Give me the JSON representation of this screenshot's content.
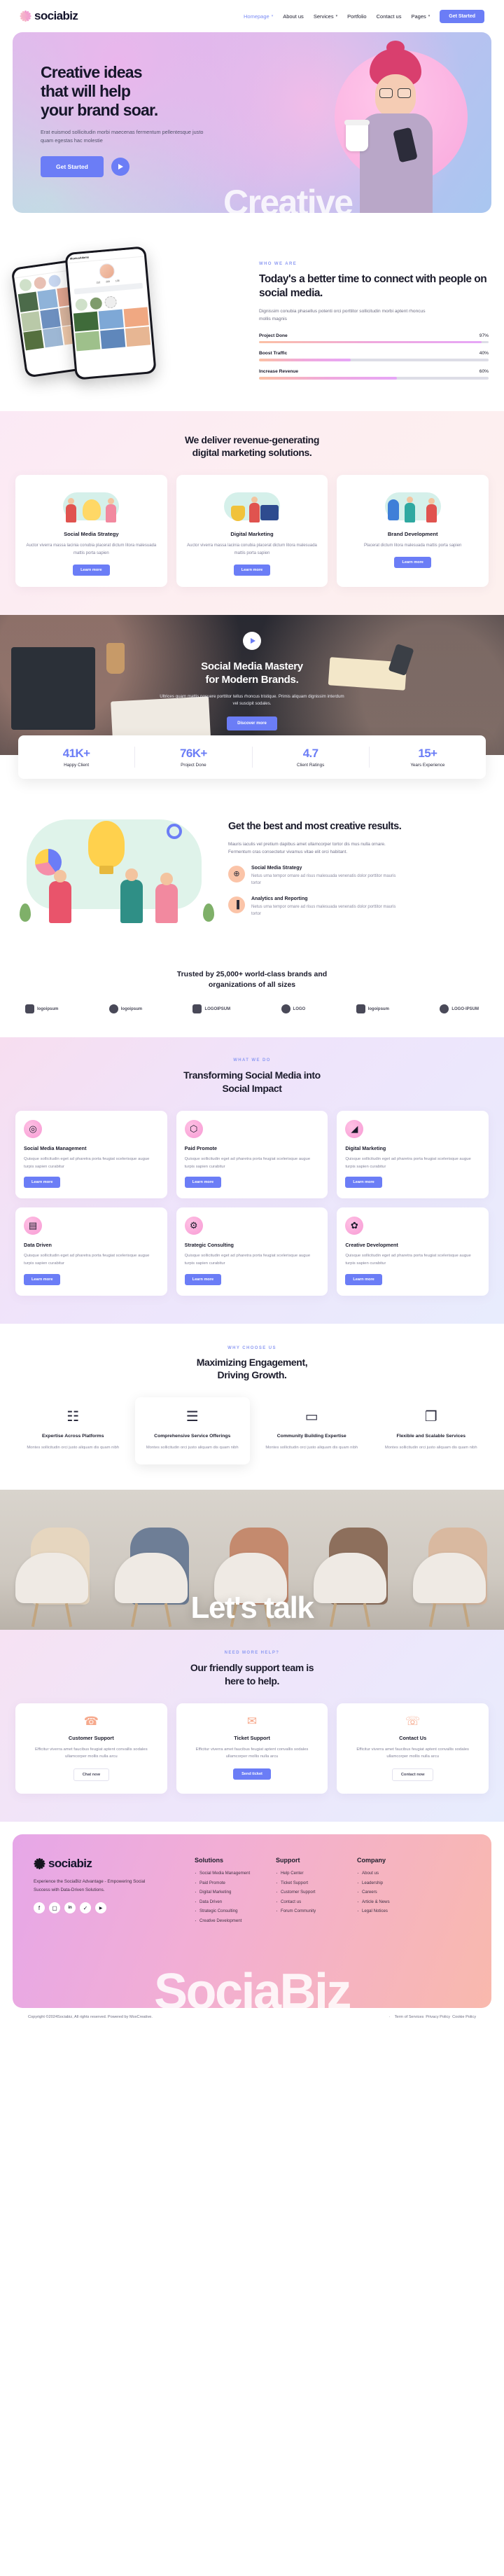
{
  "nav": {
    "brand": "sociabiz",
    "items": [
      {
        "label": "Homepage",
        "caret": true,
        "active": true
      },
      {
        "label": "About us",
        "caret": false,
        "active": false
      },
      {
        "label": "Services",
        "caret": true,
        "active": false
      },
      {
        "label": "Portfolio",
        "caret": false,
        "active": false
      },
      {
        "label": "Contact us",
        "caret": false,
        "active": false
      },
      {
        "label": "Pages",
        "caret": true,
        "active": false
      }
    ],
    "cta": "Get Started"
  },
  "hero": {
    "title_line1": "Creative ideas",
    "title_line2": "that will help",
    "title_line3": "your brand soar.",
    "paragraph": "Erat euismod sollicitudin morbi maecenas fermentum pellentesque justo quam egestas hac molestie",
    "cta": "Get Started",
    "watermark": "Creative"
  },
  "about": {
    "eyebrow": "WHO WE ARE",
    "title": "Today's a better time to connect with people on social media.",
    "paragraph": "Dignissim conubia phasellus potenti orci porttitor sollicitudin morbi aptent rhoncus mollis magnis",
    "bars": [
      {
        "label": "Project Done",
        "value": "97%",
        "pct": 97
      },
      {
        "label": "Boost Traffic",
        "value": "40%",
        "pct": 40
      },
      {
        "label": "Increase Revenue",
        "value": "60%",
        "pct": 60
      }
    ],
    "phone_profile": {
      "handle": "MonicaAdams",
      "name": "Monica Adams",
      "bio": "La description de mon profil",
      "posts": "152",
      "posts_label": "Post",
      "followers": "209",
      "followers_label": "Followers",
      "following": "138",
      "following_label": "Following",
      "edit": "Edit Profile",
      "story1": "Zorg",
      "story2": "Remove",
      "story3": "New"
    }
  },
  "services": {
    "title_line1": "We deliver revenue-generating",
    "title_line2": "digital marketing solutions.",
    "cards": [
      {
        "title": "Social Media Strategy",
        "text": "Auctor viverra massa lacinia conubia placerat dictum litora malesuada mattis porta sapien",
        "cta": "Learn more"
      },
      {
        "title": "Digital Marketing",
        "text": "Auctor viverra massa lacinia conubia placerat dictum litora malesuada mattis porta sapien",
        "cta": "Learn more"
      },
      {
        "title": "Brand Development",
        "text": "Placerat dictum litora malesuada mattis porta sapien",
        "cta": "Learn more"
      }
    ]
  },
  "video": {
    "title_line1": "Social Media Mastery",
    "title_line2": "for Modern Brands.",
    "paragraph": "Ultrices quam mattis posuere porttitor tellus rhoncus tristique. Primis aliquam dignissim interdum vel suscipit sodales.",
    "cta": "Discover more"
  },
  "stats": [
    {
      "num": "41K+",
      "label": "Happy Client"
    },
    {
      "num": "76K+",
      "label": "Project Done"
    },
    {
      "num": "4.7",
      "label": "Client Ratings"
    },
    {
      "num": "15+",
      "label": "Years Experience"
    }
  ],
  "features": {
    "title": "Get the best and most creative results.",
    "paragraph": "Mauris iaculis vel pretium dapibus amet ullamcorper tortor dis mus nulla ornare. Fermentum cras consectetur vivamus vitae elit orci habitant.",
    "items": [
      {
        "icon": "globe-icon",
        "glyph": "⊕",
        "title": "Social Media Strategy",
        "text": "Netus urna tempor ornare ad risus malesuada venenatis dolor porttitor mauris tortor"
      },
      {
        "icon": "bar-chart-icon",
        "glyph": "▐",
        "title": "Analytics and Reporting",
        "text": "Netus urna tempor ornare ad risus malesuada venenatis dolor porttitor mauris tortor"
      }
    ]
  },
  "trusted": {
    "title_line1": "Trusted by 25,000+ world-class brands and",
    "title_line2": "organizations of all sizes",
    "brands": [
      "logoipsum",
      "logoipsum",
      "LOGOIPSUM",
      "LOGO",
      "logoipsum",
      "LOGO·IPSUM"
    ]
  },
  "whatwedo": {
    "eyebrow": "WHAT WE DO",
    "title_line1": "Transforming Social Media into",
    "title_line2": "Social Impact",
    "cards": [
      {
        "icon": "target-icon",
        "glyph": "◎",
        "title": "Social Media Management",
        "text": "Quisque sollicitudin eget ad pharetra porta feugiat scelerisque augue turpis sapien curabitur",
        "cta": "Learn more"
      },
      {
        "icon": "layers-icon",
        "glyph": "⬡",
        "title": "Paid Promote",
        "text": "Quisque sollicitudin eget ad pharetra porta feugiat scelerisque augue turpis sapien curabitur",
        "cta": "Learn more"
      },
      {
        "icon": "megaphone-icon",
        "glyph": "◢",
        "title": "Digital Marketing",
        "text": "Quisque sollicitudin eget ad pharetra porta feugiat scelerisque augue turpis sapien curabitur",
        "cta": "Learn more"
      },
      {
        "icon": "database-icon",
        "glyph": "▤",
        "title": "Data Driven",
        "text": "Quisque sollicitudin eget ad pharetra porta feugiat scelerisque augue turpis sapien curabitur",
        "cta": "Learn more"
      },
      {
        "icon": "strategy-icon",
        "glyph": "⚙",
        "title": "Strategic Consulting",
        "text": "Quisque sollicitudin eget ad pharetra porta feugiat scelerisque augue turpis sapien curabitur",
        "cta": "Learn more"
      },
      {
        "icon": "palette-icon",
        "glyph": "✿",
        "title": "Creative Development",
        "text": "Quisque sollicitudin eget ad pharetra porta feugiat scelerisque augue turpis sapien curabitur",
        "cta": "Learn more"
      }
    ]
  },
  "maximizing": {
    "eyebrow": "WHY CHOOSE US",
    "title_line1": "Maximizing Engagement,",
    "title_line2": "Driving Growth.",
    "cards": [
      {
        "icon": "document-refresh-icon",
        "glyph": "☷",
        "title": "Expertise Across Platforms",
        "text": "Montes sollicitudin orci justo aliquam dis quam nibh",
        "active": false
      },
      {
        "icon": "checklist-icon",
        "glyph": "☰",
        "title": "Comprehensive Service Offerings",
        "text": "Montes sollicitudin orci justo aliquam dis quam nibh",
        "active": true
      },
      {
        "icon": "chat-bubble-icon",
        "glyph": "▭",
        "title": "Community Building Expertise",
        "text": "Montes sollicitudin orci justo aliquam dis quam nibh",
        "active": false
      },
      {
        "icon": "documents-icon",
        "glyph": "❐",
        "title": "Flexible and Scalable Services",
        "text": "Montes sollicitudin orci justo aliquam dis quam nibh",
        "active": false
      }
    ]
  },
  "talk": {
    "watermark": "Let's talk"
  },
  "support": {
    "eyebrow": "NEED MORE HELP?",
    "title_line1": "Our friendly support team is",
    "title_line2": "here to help.",
    "cards": [
      {
        "icon": "headset-icon",
        "glyph": "☎",
        "title": "Customer Support",
        "text": "Efficitur viverra amet faucibus feugiat aptent convallis sodales ullamcorper mollis nulla arcu",
        "cta": "Chat now",
        "style": "light"
      },
      {
        "icon": "ticket-icon",
        "glyph": "✉",
        "title": "Ticket Support",
        "text": "Efficitur viverra amet faucibus feugiat aptent convallis sodales ullamcorper mollis nulla arcu",
        "cta": "Send ticket",
        "style": "dark"
      },
      {
        "icon": "phone-icon",
        "glyph": "☏",
        "title": "Contact Us",
        "text": "Efficitur viverra amet faucibus feugiat aptent convallis sodales ullamcorper mollis nulla arcu",
        "cta": "Contact now",
        "style": "light"
      }
    ]
  },
  "footer": {
    "brand": "sociabiz",
    "tagline": "Experience the SociaBiz Advantage - Empowering Social Success with Data-Driven Solutions.",
    "socials": [
      {
        "name": "facebook-icon",
        "glyph": "f"
      },
      {
        "name": "instagram-icon",
        "glyph": "▢"
      },
      {
        "name": "linkedin-icon",
        "glyph": "in"
      },
      {
        "name": "twitter-icon",
        "glyph": "✓"
      },
      {
        "name": "youtube-icon",
        "glyph": "▶"
      }
    ],
    "columns": [
      {
        "title": "Solutions",
        "links": [
          "Social Media Management",
          "Paid Promote",
          "Digital Marketing",
          "Data Driven",
          "Strategic Consulting",
          "Creative Development"
        ]
      },
      {
        "title": "Support",
        "links": [
          "Help Center",
          "Ticket Support",
          "Customer Support",
          "Contact us",
          "Forum Community"
        ]
      },
      {
        "title": "Company",
        "links": [
          "About us",
          "Leadership",
          "Careers",
          "Article & News",
          "Legal Notices"
        ]
      }
    ],
    "watermark": "SociaBiz",
    "copyright": "Copyright ©2024Sociabiz, All rights reserved. Powered by MoxCreative.",
    "legal": [
      "Term of Services",
      "Privacy Policy",
      "Cookie Policy"
    ]
  }
}
